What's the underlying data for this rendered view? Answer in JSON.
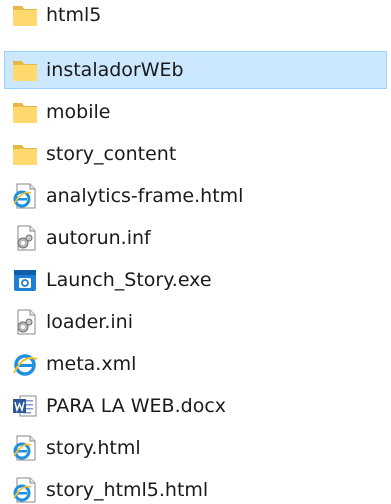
{
  "files": [
    {
      "name": "html5",
      "icon": "folder-icon",
      "selected": false
    },
    {
      "name": "instaladorWEb",
      "icon": "folder-icon",
      "selected": true
    },
    {
      "name": "mobile",
      "icon": "folder-icon",
      "selected": false
    },
    {
      "name": "story_content",
      "icon": "folder-icon",
      "selected": false
    },
    {
      "name": "analytics-frame.html",
      "icon": "html-document-icon",
      "selected": false
    },
    {
      "name": "autorun.inf",
      "icon": "settings-file-icon",
      "selected": false
    },
    {
      "name": "Launch_Story.exe",
      "icon": "application-icon",
      "selected": false
    },
    {
      "name": "loader.ini",
      "icon": "settings-file-icon",
      "selected": false
    },
    {
      "name": "meta.xml",
      "icon": "xml-file-icon",
      "selected": false
    },
    {
      "name": "PARA LA WEB.docx",
      "icon": "word-document-icon",
      "selected": false
    },
    {
      "name": "story.html",
      "icon": "html-document-icon",
      "selected": false
    },
    {
      "name": "story_html5.html",
      "icon": "html-document-icon",
      "selected": false
    }
  ],
  "colors": {
    "selection_fill": "#cce8ff",
    "selection_border": "#99d1ff",
    "folder": "#ffd86e",
    "ie_blue": "#1e90e0",
    "word_blue": "#2b579a"
  }
}
